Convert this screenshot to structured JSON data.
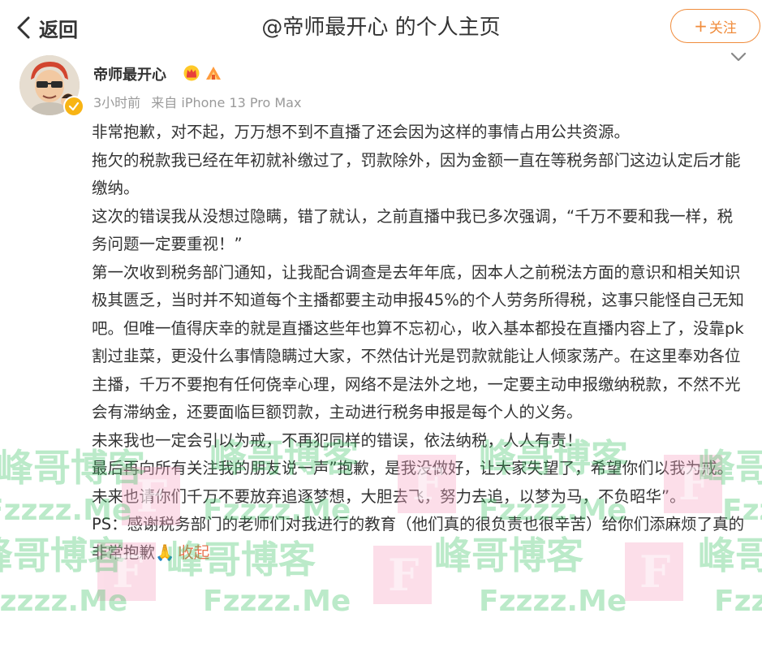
{
  "header": {
    "back_label": "返回",
    "title": "@帝师最开心 的个人主页",
    "follow_label": "关注",
    "follow_plus": "+"
  },
  "post": {
    "username": "帝师最开心",
    "time": "3小时前",
    "source": "来自 iPhone 13 Pro Max",
    "paragraphs": [
      "非常抱歉，对不起，万万想不到不直播了还会因为这样的事情占用公共资源。",
      "拖欠的税款我已经在年初就补缴过了，罚款除外，因为金额一直在等税务部门这边认定后才能缴纳。",
      "这次的错误我从没想过隐瞒，错了就认，之前直播中我已多次强调，“千万不要和我一样，税务问题一定要重视！”",
      "第一次收到税务部门通知，让我配合调查是去年年底，因本人之前税法方面的意识和相关知识极其匮乏，当时并不知道每个主播都要主动申报45%的个人劳务所得税，这事只能怪自己无知吧。但唯一值得庆幸的就是直播这些年也算不忘初心，收入基本都投在直播内容上了，没靠pk割过韭菜，更没什么事情隐瞒过大家，不然估计光是罚款就能让人倾家荡产。在这里奉劝各位主播，千万不要抱有任何侥幸心理，网络不是法外之地，一定要主动申报缴纳税款，不然不光会有滞纳金，还要面临巨额罚款，主动进行税务申报是每个人的义务。",
      "未来我也一定会引以为戒，不再犯同样的错误，依法纳税，人人有责！",
      "最后再向所有关注我的朋友说一声”抱歉，是我没做好，让大家失望了，希望你们以我为戒。   未来也请你们千万不要放弃追逐梦想，大胆去飞，努力去追，以梦为马，不负昭华”。"
    ],
    "ps_text": "PS：感谢税务部门的老师们对我进行的教育（他们真的很负责也很辛苦）给你们添麻烦了真的非常抱歉",
    "ps_emoji": "🙏",
    "collapse_label": "收起"
  },
  "watermark": {
    "text_cn": "峰哥博客",
    "text_url": "Fzzzz.Me",
    "letter": "F"
  },
  "colors": {
    "accent": "#f08c3c",
    "link": "#eb7350",
    "meta": "#9a9a9a",
    "watermark_green": "#2fbf5a",
    "watermark_pink": "#f7a8c4"
  },
  "icons": [
    "back-chevron-icon",
    "chevron-down-icon",
    "verified-icon",
    "crown-badge-icon",
    "fan-badge-icon",
    "pray-emoji-icon"
  ]
}
